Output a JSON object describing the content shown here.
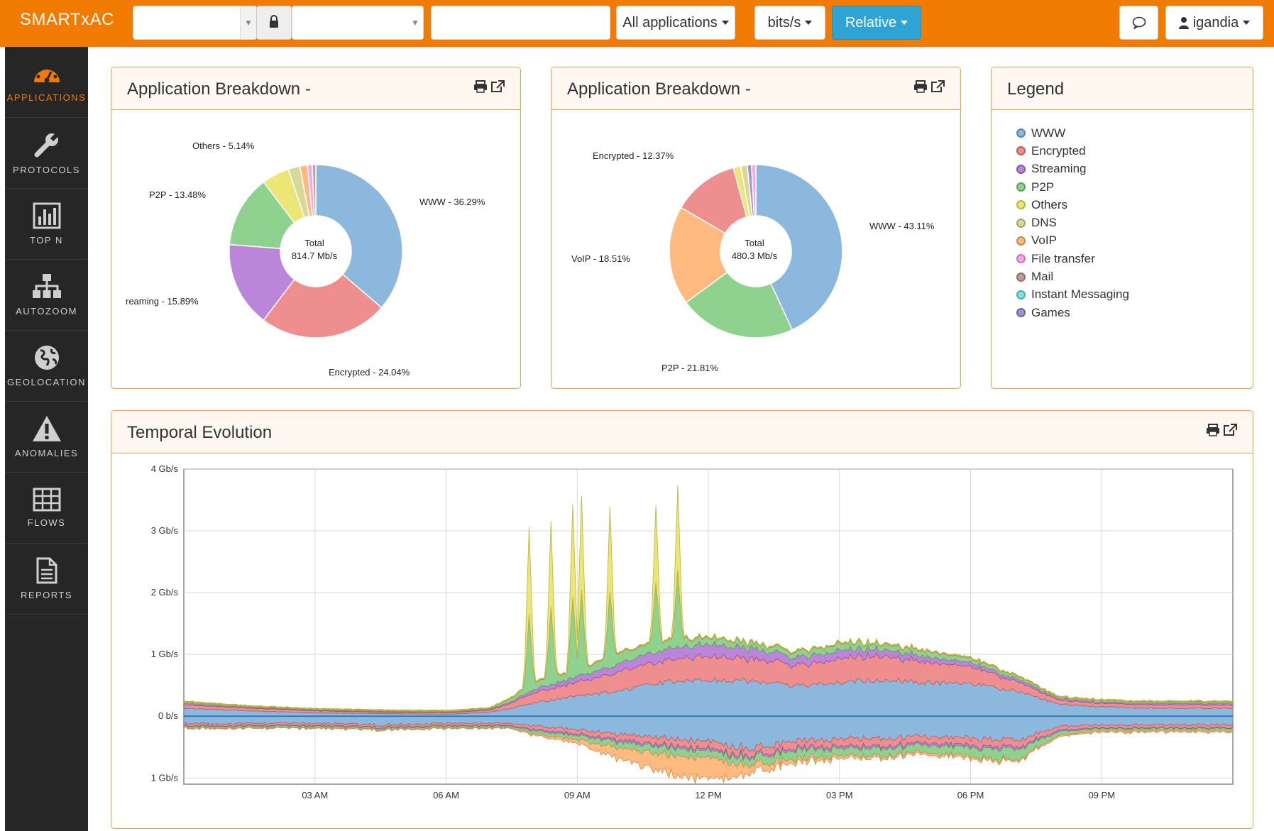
{
  "topbar": {
    "brand": "SMARTxAC",
    "filter1_value": "",
    "filter2_value": "",
    "search_value": "",
    "applications_label": "All applications",
    "units_label": "bits/s",
    "mode_label": "Relative",
    "user_label": "igandia"
  },
  "sidebar": {
    "items": [
      {
        "label": "APPLICATIONS",
        "icon": "dashboard-icon"
      },
      {
        "label": "PROTOCOLS",
        "icon": "wrench-icon"
      },
      {
        "label": "TOP N",
        "icon": "bar-chart-icon"
      },
      {
        "label": "AUTOZOOM",
        "icon": "sitemap-icon"
      },
      {
        "label": "GEOLOCATION",
        "icon": "globe-icon"
      },
      {
        "label": "ANOMALIES",
        "icon": "warning-icon"
      },
      {
        "label": "FLOWS",
        "icon": "table-grid-icon"
      },
      {
        "label": "REPORTS",
        "icon": "document-icon"
      }
    ],
    "active": "APPLICATIONS"
  },
  "panels": {
    "breakdown1": {
      "title": "Application Breakdown -",
      "total_label": "Total",
      "total_value": "814.7 Mb/s",
      "labels": [
        "WWW - 36.29%",
        "Encrypted - 24.04%",
        "reaming - 15.89%",
        "P2P - 13.48%",
        "Others - 5.14%"
      ]
    },
    "breakdown2": {
      "title": "Application Breakdown -",
      "total_label": "Total",
      "total_value": "480.3 Mb/s",
      "labels": [
        "WWW - 43.11%",
        "P2P - 21.81%",
        "VoIP - 18.51%",
        "Encrypted - 12.37%"
      ]
    },
    "legend": {
      "title": "Legend",
      "items": [
        {
          "name": "WWW",
          "color": "#8cb8de"
        },
        {
          "name": "Encrypted",
          "color": "#ee8e8e"
        },
        {
          "name": "Streaming",
          "color": "#bb86d9"
        },
        {
          "name": "P2P",
          "color": "#8fd18e"
        },
        {
          "name": "Others",
          "color": "#ece677"
        },
        {
          "name": "DNS",
          "color": "#d8d89a"
        },
        {
          "name": "VoIP",
          "color": "#ffbb7f"
        },
        {
          "name": "File transfer",
          "color": "#f7a8e6"
        },
        {
          "name": "Mail",
          "color": "#c0a09a"
        },
        {
          "name": "Instant Messaging",
          "color": "#7fe0e8"
        },
        {
          "name": "Games",
          "color": "#9a98c8"
        }
      ]
    },
    "temporal": {
      "title": "Temporal Evolution"
    }
  },
  "chart_data": [
    {
      "type": "pie",
      "title": "Application Breakdown -",
      "center_text": [
        "Total",
        "814.7 Mb/s"
      ],
      "slices": [
        {
          "name": "WWW",
          "value": 36.29,
          "color": "#8cb8de"
        },
        {
          "name": "Encrypted",
          "value": 24.04,
          "color": "#ee8e8e"
        },
        {
          "name": "Streaming",
          "value": 15.89,
          "color": "#bb86d9"
        },
        {
          "name": "P2P",
          "value": 13.48,
          "color": "#8fd18e"
        },
        {
          "name": "Others",
          "value": 5.14,
          "color": "#ece677"
        },
        {
          "name": "DNS",
          "value": 2.2,
          "color": "#d8d89a"
        },
        {
          "name": "VoIP",
          "value": 1.4,
          "color": "#ffbb7f"
        },
        {
          "name": "File transfer",
          "value": 0.9,
          "color": "#f7a8e6"
        },
        {
          "name": "Mail",
          "value": 0.66,
          "color": "#c0a09a"
        }
      ]
    },
    {
      "type": "pie",
      "title": "Application Breakdown -",
      "center_text": [
        "Total",
        "480.3 Mb/s"
      ],
      "slices": [
        {
          "name": "WWW",
          "value": 43.11,
          "color": "#8cb8de"
        },
        {
          "name": "P2P",
          "value": 21.81,
          "color": "#8fd18e"
        },
        {
          "name": "VoIP",
          "value": 18.51,
          "color": "#ffbb7f"
        },
        {
          "name": "Encrypted",
          "value": 12.37,
          "color": "#ee8e8e"
        },
        {
          "name": "Others",
          "value": 1.4,
          "color": "#ece677"
        },
        {
          "name": "DNS",
          "value": 1.2,
          "color": "#d8d89a"
        },
        {
          "name": "Games",
          "value": 0.8,
          "color": "#9a98c8"
        },
        {
          "name": "File transfer",
          "value": 0.8,
          "color": "#f7a8e6"
        }
      ]
    },
    {
      "type": "area",
      "title": "Temporal Evolution",
      "x_ticks": [
        "03 AM",
        "06 AM",
        "09 AM",
        "12 PM",
        "03 PM",
        "06 PM",
        "09 PM"
      ],
      "y_ticks": [
        "4 Gb/s",
        "3 Gb/s",
        "2 Gb/s",
        "1 Gb/s",
        "0 b/s",
        "1 Gb/s"
      ],
      "x_range_hours": [
        0,
        24
      ],
      "y_range_gbps": [
        -1.1,
        4
      ],
      "grid": true,
      "series": [
        {
          "name": "WWW",
          "color": "#8cb8de",
          "x": [
            0,
            1.5,
            3,
            4.5,
            6,
            7,
            7.5,
            8,
            9,
            10,
            11,
            12,
            13,
            14,
            15,
            16,
            17,
            18,
            19,
            20,
            21,
            22,
            23,
            24
          ],
          "up": [
            0.12,
            0.08,
            0.05,
            0.04,
            0.03,
            0.06,
            0.12,
            0.2,
            0.3,
            0.38,
            0.5,
            0.55,
            0.52,
            0.45,
            0.5,
            0.55,
            0.5,
            0.48,
            0.38,
            0.18,
            0.14,
            0.12,
            0.12,
            0.12
          ],
          "down": [
            0.1,
            0.1,
            0.1,
            0.12,
            0.1,
            0.1,
            0.1,
            0.14,
            0.18,
            0.25,
            0.3,
            0.35,
            0.45,
            0.35,
            0.32,
            0.3,
            0.28,
            0.3,
            0.35,
            0.15,
            0.12,
            0.12,
            0.12,
            0.12
          ]
        },
        {
          "name": "Encrypted",
          "color": "#ee8e8e",
          "x": [
            0,
            1.5,
            3,
            4.5,
            6,
            7,
            7.5,
            8,
            9,
            10,
            11,
            12,
            13,
            14,
            15,
            16,
            17,
            18,
            19,
            20,
            21,
            22,
            23,
            24
          ],
          "up": [
            0.05,
            0.04,
            0.03,
            0.02,
            0.02,
            0.03,
            0.08,
            0.15,
            0.2,
            0.28,
            0.32,
            0.35,
            0.33,
            0.3,
            0.35,
            0.36,
            0.3,
            0.25,
            0.15,
            0.06,
            0.05,
            0.05,
            0.05,
            0.05
          ],
          "down": [
            0.03,
            0.03,
            0.03,
            0.03,
            0.03,
            0.03,
            0.03,
            0.05,
            0.06,
            0.08,
            0.1,
            0.1,
            0.1,
            0.1,
            0.1,
            0.1,
            0.09,
            0.1,
            0.1,
            0.05,
            0.04,
            0.04,
            0.04,
            0.04
          ]
        },
        {
          "name": "Streaming",
          "color": "#bb86d9",
          "x": [
            0,
            1.5,
            3,
            4.5,
            6,
            7,
            7.5,
            8,
            9,
            10,
            11,
            12,
            13,
            14,
            15,
            16,
            17,
            18,
            19,
            20,
            21,
            22,
            23,
            24
          ],
          "up": [
            0.02,
            0.01,
            0.01,
            0.01,
            0.01,
            0.01,
            0.02,
            0.05,
            0.08,
            0.12,
            0.16,
            0.18,
            0.15,
            0.12,
            0.12,
            0.1,
            0.08,
            0.06,
            0.04,
            0.02,
            0.02,
            0.02,
            0.02,
            0.02
          ],
          "down": [
            0.01,
            0.01,
            0.01,
            0.01,
            0.01,
            0.01,
            0.01,
            0.02,
            0.02,
            0.03,
            0.03,
            0.03,
            0.03,
            0.03,
            0.03,
            0.03,
            0.03,
            0.03,
            0.03,
            0.02,
            0.01,
            0.01,
            0.01,
            0.01
          ]
        },
        {
          "name": "P2P",
          "color": "#8fd18e",
          "x": [
            0,
            1.5,
            3,
            4.5,
            6,
            7,
            7.5,
            8,
            9,
            10,
            11,
            12,
            13,
            14,
            15,
            16,
            17,
            18,
            19,
            20,
            21,
            22,
            23,
            24
          ],
          "up": [
            0.02,
            0.01,
            0.01,
            0.01,
            0.01,
            0.01,
            0.05,
            0.1,
            0.1,
            0.15,
            0.12,
            0.1,
            0.08,
            0.08,
            0.1,
            0.08,
            0.08,
            0.06,
            0.04,
            0.02,
            0.02,
            0.02,
            0.02,
            0.02
          ],
          "down": [
            0.02,
            0.02,
            0.02,
            0.02,
            0.02,
            0.02,
            0.02,
            0.04,
            0.06,
            0.08,
            0.1,
            0.1,
            0.1,
            0.12,
            0.1,
            0.1,
            0.1,
            0.12,
            0.15,
            0.05,
            0.03,
            0.03,
            0.03,
            0.03
          ]
        },
        {
          "name": "VoIP",
          "color": "#ffbb7f",
          "x": [
            0,
            1.5,
            3,
            4.5,
            6,
            7,
            7.5,
            8,
            9,
            10,
            11,
            12,
            13,
            14,
            15,
            16,
            17,
            18,
            19,
            20,
            21,
            22,
            23,
            24
          ],
          "up": [
            0.01,
            0.01,
            0.01,
            0.01,
            0.01,
            0.01,
            0.01,
            0.01,
            0.01,
            0.01,
            0.01,
            0.01,
            0.01,
            0.01,
            0.01,
            0.01,
            0.01,
            0.01,
            0.01,
            0.01,
            0.01,
            0.01,
            0.01,
            0.01
          ],
          "down": [
            0.01,
            0.01,
            0.01,
            0.01,
            0.01,
            0.01,
            0.01,
            0.02,
            0.05,
            0.15,
            0.25,
            0.3,
            0.1,
            0.05,
            0.04,
            0.03,
            0.03,
            0.03,
            0.02,
            0.02,
            0.02,
            0.02,
            0.02,
            0.02
          ]
        }
      ],
      "spikes": [
        {
          "x": 7.9,
          "peak": 3.45
        },
        {
          "x": 8.4,
          "peak": 3.4
        },
        {
          "x": 8.9,
          "peak": 3.6
        },
        {
          "x": 9.1,
          "peak": 3.65
        },
        {
          "x": 9.75,
          "peak": 3.35
        },
        {
          "x": 10.8,
          "peak": 3.15
        },
        {
          "x": 11.3,
          "peak": 3.35
        }
      ]
    }
  ]
}
